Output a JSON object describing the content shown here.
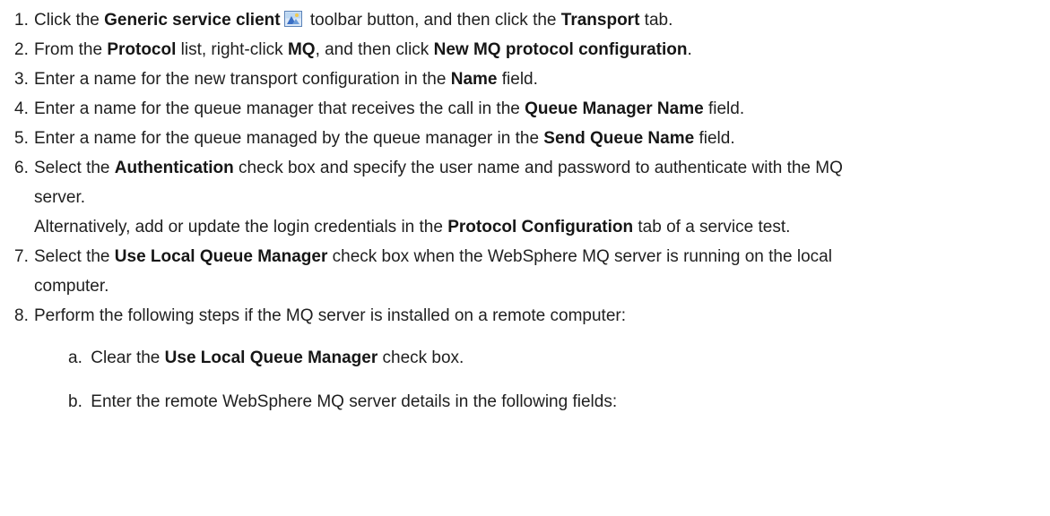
{
  "steps": {
    "s1": {
      "num": "1.",
      "t1": "Click the ",
      "b1": "Generic service client",
      "t2": " toolbar button, and then click the ",
      "b2": "Transport",
      "t3": " tab.",
      "icon": "generic-service-client-icon"
    },
    "s2": {
      "num": "2.",
      "t1": "From the ",
      "b1": "Protocol",
      "t2": " list, right-click ",
      "b2": "MQ",
      "t3": ", and then click ",
      "b3": "New MQ protocol configuration",
      "t4": "."
    },
    "s3": {
      "num": "3.",
      "t1": "Enter a name for the new transport configuration in the ",
      "b1": "Name",
      "t2": " field."
    },
    "s4": {
      "num": "4.",
      "t1": "Enter a name for the queue manager that receives the call in the ",
      "b1": "Queue Manager Name",
      "t2": " field."
    },
    "s5": {
      "num": "5.",
      "t1": "Enter a name for the queue managed by the queue manager in the ",
      "b1": "Send Queue Name",
      "t2": " field."
    },
    "s6": {
      "num": "6.",
      "t1": "Select the ",
      "b1": "Authentication",
      "t2": " check box and specify the user name and password to authenticate with the MQ",
      "line2": "server.",
      "alt1": "Alternatively, add or update the login credentials in the ",
      "altb": "Protocol Configuration",
      "alt2": " tab of a service test."
    },
    "s7": {
      "num": "7.",
      "t1": "Select the ",
      "b1": "Use Local Queue Manager",
      "t2": " check box when the WebSphere MQ server is running on the local",
      "line2": "computer."
    },
    "s8": {
      "num": "8.",
      "t1": "Perform the following steps if the MQ server is installed on a remote computer:",
      "sa": {
        "num": "a.",
        "t1": "Clear the ",
        "b1": "Use Local Queue Manager",
        "t2": " check box."
      },
      "sb": {
        "num": "b.",
        "t1": "Enter the remote WebSphere MQ server details in the following fields:"
      }
    }
  },
  "colors": {
    "text": "#1f1f1f",
    "icon_blue": "#3a6fc4",
    "icon_sky": "#bcd7f2"
  }
}
